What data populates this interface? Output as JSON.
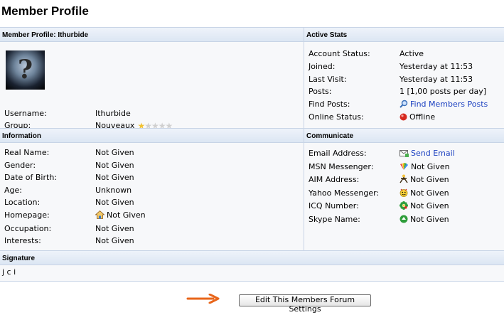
{
  "page_title": "Member Profile",
  "sections": {
    "profile_header": "Member Profile: Ithurbide",
    "stats_header": "Active Stats",
    "information_header": "Information",
    "communicate_header": "Communicate",
    "signature_header": "Signature"
  },
  "profile": {
    "username_label": "Username:",
    "username": "Ithurbide",
    "group_label": "Group:",
    "group": "Nouveaux",
    "rating_stars": 1,
    "rating_max": 5
  },
  "stats": [
    {
      "label": "Account Status:",
      "value": "Active"
    },
    {
      "label": "Joined:",
      "value": "Yesterday at 11:53"
    },
    {
      "label": "Last Visit:",
      "value": "Yesterday at 11:53"
    },
    {
      "label": "Posts:",
      "value": "1 [1,00 posts per day]"
    },
    {
      "label": "Find Posts:",
      "value": "Find Members Posts",
      "icon": "magnifier-icon"
    },
    {
      "label": "Online Status:",
      "value": "Offline",
      "icon": "offline-status-icon"
    }
  ],
  "information": [
    {
      "label": "Real Name:",
      "value": "Not Given"
    },
    {
      "label": "Gender:",
      "value": "Not Given"
    },
    {
      "label": "Date of Birth:",
      "value": "Not Given"
    },
    {
      "label": "Age:",
      "value": "Unknown"
    },
    {
      "label": "Location:",
      "value": "Not Given"
    },
    {
      "label": "Homepage:",
      "value": "Not Given",
      "icon": "home-icon"
    },
    {
      "label": "Occupation:",
      "value": "Not Given"
    },
    {
      "label": "Interests:",
      "value": "Not Given"
    }
  ],
  "communicate": [
    {
      "label": "Email Address:",
      "value": "Send Email",
      "icon": "email-icon"
    },
    {
      "label": "MSN Messenger:",
      "value": "Not Given",
      "icon": "msn-icon"
    },
    {
      "label": "AIM Address:",
      "value": "Not Given",
      "icon": "aim-icon"
    },
    {
      "label": "Yahoo Messenger:",
      "value": "Not Given",
      "icon": "yahoo-icon"
    },
    {
      "label": "ICQ Number:",
      "value": "Not Given",
      "icon": "icq-icon"
    },
    {
      "label": "Skype Name:",
      "value": "Not Given",
      "icon": "skype-icon"
    }
  ],
  "signature": "j c i",
  "edit_button": "Edit This Members Forum Settings",
  "colors": {
    "header_bg": "#dce6f3",
    "panel_bg": "#f7f8fa",
    "link": "#1a3fc0",
    "arrow": "#e8651a"
  }
}
